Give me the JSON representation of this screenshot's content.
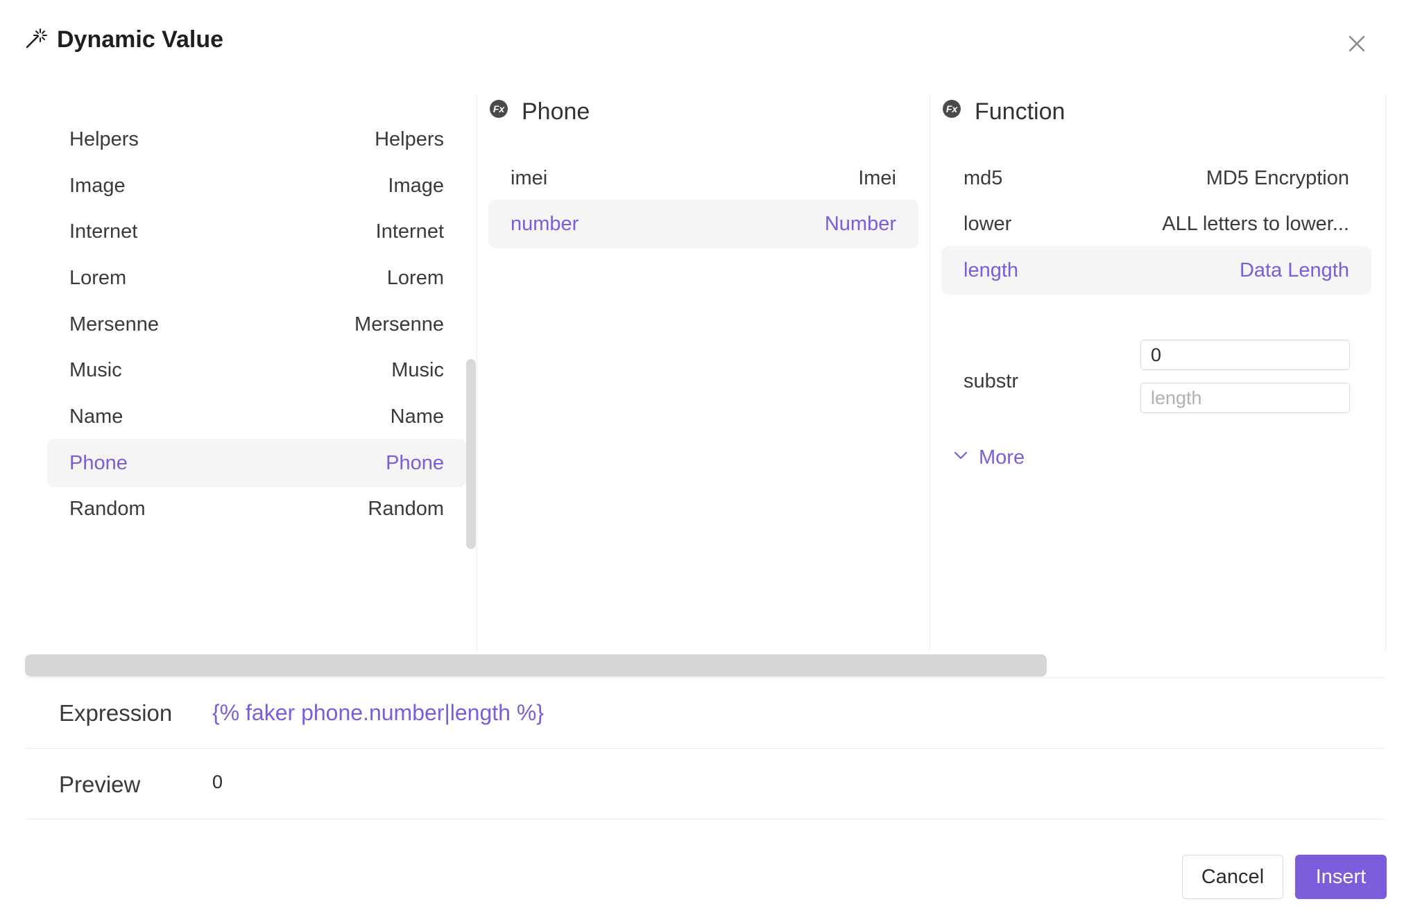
{
  "dialog": {
    "title": "Dynamic Value",
    "title_icon": "magic-wand-icon",
    "close_icon": "close-icon"
  },
  "categories": [
    {
      "name": "Helpers",
      "label": "Helpers",
      "active": false
    },
    {
      "name": "Image",
      "label": "Image",
      "active": false
    },
    {
      "name": "Internet",
      "label": "Internet",
      "active": false
    },
    {
      "name": "Lorem",
      "label": "Lorem",
      "active": false
    },
    {
      "name": "Mersenne",
      "label": "Mersenne",
      "active": false
    },
    {
      "name": "Music",
      "label": "Music",
      "active": false
    },
    {
      "name": "Name",
      "label": "Name",
      "active": false
    },
    {
      "name": "Phone",
      "label": "Phone",
      "active": true
    },
    {
      "name": "Random",
      "label": "Random",
      "active": false
    }
  ],
  "phone_column": {
    "title": "Phone",
    "icon": "fx-icon",
    "items": [
      {
        "name": "imei",
        "label": "Imei",
        "active": false
      },
      {
        "name": "number",
        "label": "Number",
        "active": true
      }
    ]
  },
  "function_column": {
    "title": "Function",
    "icon": "fx-icon",
    "items": [
      {
        "name": "md5",
        "label": "MD5 Encryption",
        "active": false
      },
      {
        "name": "lower",
        "label": "ALL letters to lower...",
        "active": false
      },
      {
        "name": "length",
        "label": "Data Length",
        "active": true
      }
    ],
    "substr": {
      "label": "substr",
      "start_value": "0",
      "length_placeholder": "length"
    },
    "more_label": "More",
    "more_icon": "chevron-down-icon"
  },
  "expression": {
    "label": "Expression",
    "value": "{% faker phone.number|length %}"
  },
  "preview": {
    "label": "Preview",
    "value": "0"
  },
  "footer": {
    "cancel_label": "Cancel",
    "insert_label": "Insert"
  },
  "colors": {
    "accent": "#7b5cdb",
    "active_bg": "#f5f5f5",
    "text": "#3a3a3a",
    "border": "#d9d9d9"
  }
}
